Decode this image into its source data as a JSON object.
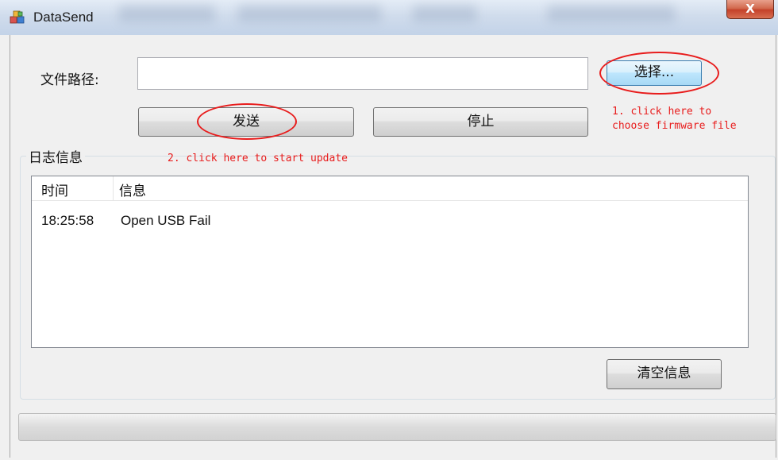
{
  "window": {
    "title": "DataSend",
    "close_label": "X"
  },
  "file": {
    "label": "文件路径:",
    "path_value": "",
    "browse_label": "选择..."
  },
  "actions": {
    "send_label": "发送",
    "stop_label": "停止"
  },
  "log": {
    "group_title": "日志信息",
    "columns": [
      "时间",
      "信息"
    ],
    "rows": [
      {
        "time": "18:25:58",
        "message": "Open USB Fail"
      }
    ],
    "clear_label": "清空信息"
  },
  "annotations": {
    "step1_line1": "1. click here to",
    "step1_line2": "choose firmware file",
    "step2": "2. click here to start update"
  },
  "progress": {
    "value": 0
  },
  "colors": {
    "annotation": "#e81c1c",
    "titlebar": "#d0dcec",
    "close": "#c4412a"
  }
}
